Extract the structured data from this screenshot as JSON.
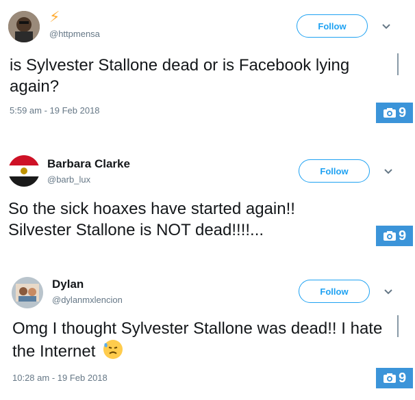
{
  "tweets": [
    {
      "name": "⚡",
      "handle": "@httpmensa",
      "follow_label": "Follow",
      "text": "is Sylvester Stallone dead or is Facebook lying again?",
      "time": "5:59 am - 19 Feb 2018",
      "photo_count": "9",
      "avatar_icon": "avatar-photo"
    },
    {
      "name": "Barbara Clarke",
      "handle": "@barb_lux",
      "follow_label": "Follow",
      "text": "So the sick hoaxes have started again!! Silvester Stallone is NOT dead!!!!...",
      "time": "",
      "photo_count": "9",
      "avatar_icon": "avatar-flag"
    },
    {
      "name": "Dylan",
      "handle": "@dylanmxlencion",
      "follow_label": "Follow",
      "text": "Omg I thought Sylvester Stallone was dead!! I hate the Internet",
      "emoji": "downcast-face-with-sweat",
      "time": "10:28 am - 19 Feb 2018",
      "photo_count": "9",
      "avatar_icon": "avatar-photo"
    }
  ],
  "colors": {
    "accent": "#1da1f2",
    "badge": "#3b94d9",
    "muted": "#657786"
  }
}
